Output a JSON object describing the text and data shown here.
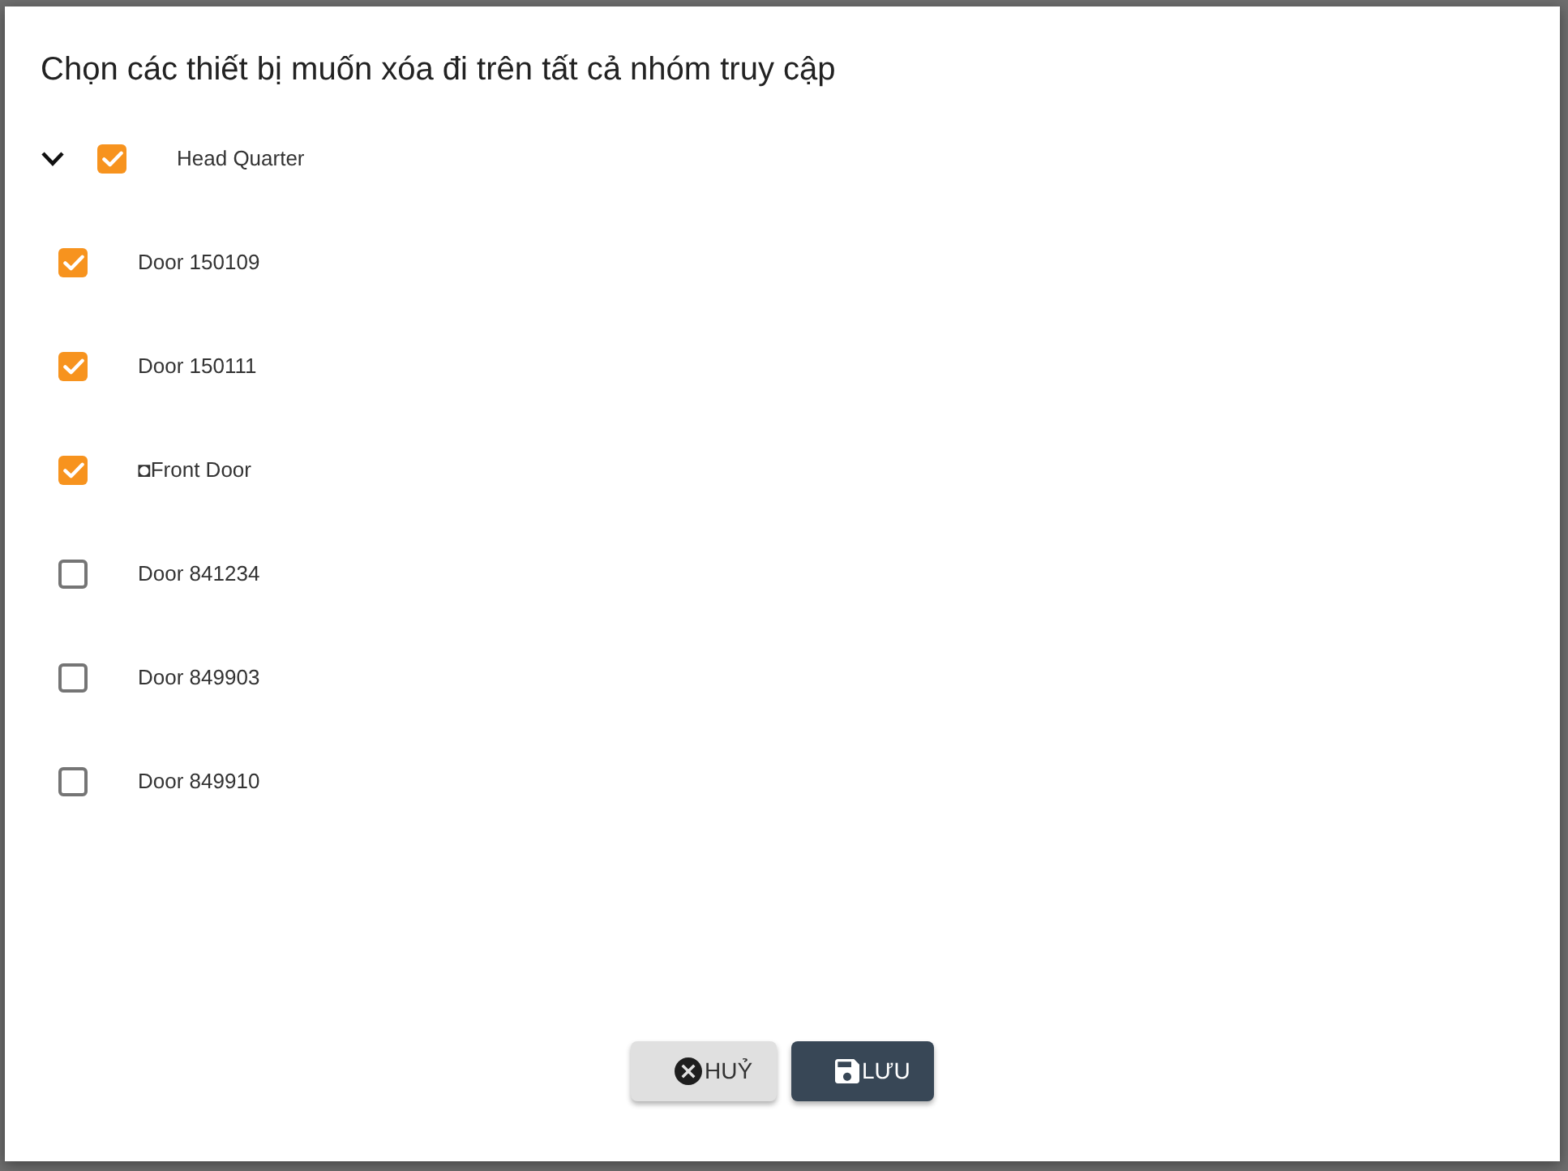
{
  "dialog": {
    "title": "Chọn các thiết bị muốn xóa đi trên tất cả nhóm truy cập"
  },
  "tree": [
    {
      "label": "Head Quarter",
      "expanded": true,
      "checked": true,
      "children": [
        {
          "label": "Door 150109",
          "checked": true
        },
        {
          "label": "Door 150111",
          "checked": true
        },
        {
          "label": "◘Front Door",
          "checked": true
        },
        {
          "label": "Door 841234",
          "checked": false
        },
        {
          "label": "Door 849903",
          "checked": false
        },
        {
          "label": "Door 849910",
          "checked": false
        }
      ]
    }
  ],
  "buttons": [
    {
      "kind": "cancel",
      "label": "HUỶ"
    },
    {
      "kind": "save",
      "label": "LƯU"
    }
  ]
}
